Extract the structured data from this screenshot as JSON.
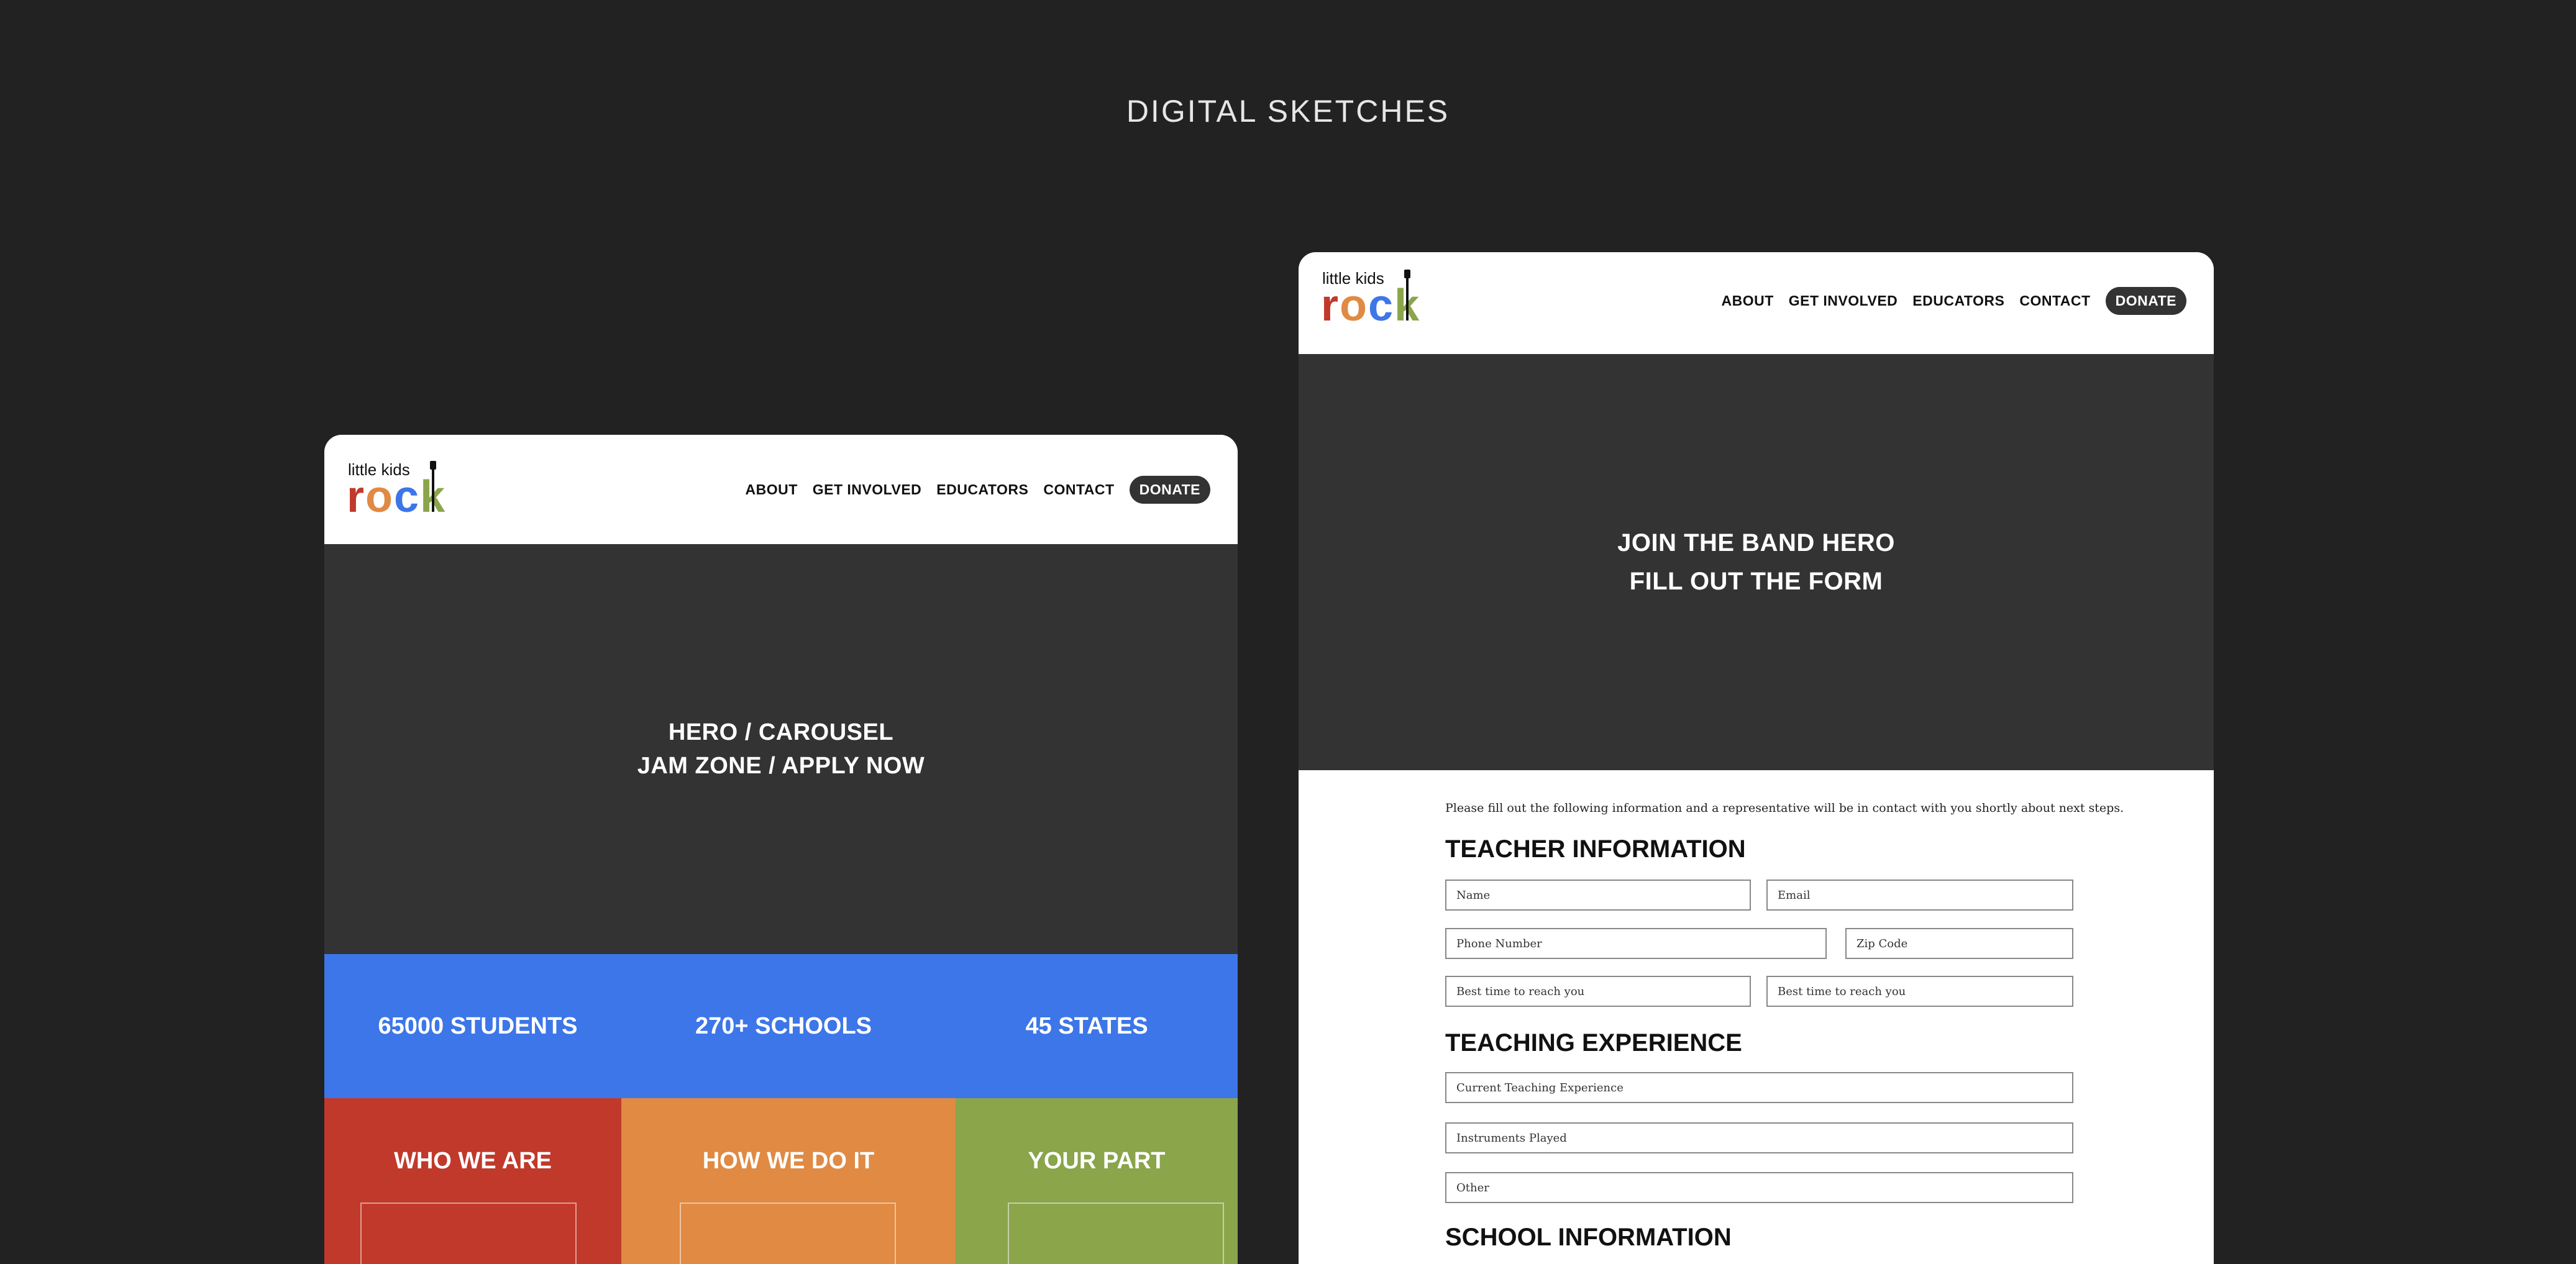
{
  "page_title": "DIGITAL SKETCHES",
  "logo": {
    "small_text": "little kids",
    "big_text": "rock",
    "letters": [
      "r",
      "o",
      "c",
      "k"
    ],
    "letter_colors": [
      "#c0392b",
      "#e08a44",
      "#3d76e8",
      "#8aa54a"
    ]
  },
  "nav": {
    "items": [
      "ABOUT",
      "GET INVOLVED",
      "EDUCATORS",
      "CONTACT"
    ],
    "donate": "DONATE"
  },
  "left_sketch": {
    "hero_lines": [
      "HERO / CAROUSEL",
      "JAM ZONE / APPLY NOW"
    ],
    "stats": [
      "65000 STUDENTS",
      "270+ SCHOOLS",
      "45 STATES"
    ],
    "cards": [
      {
        "title": "WHO WE ARE",
        "color": "#c0392b"
      },
      {
        "title": "HOW WE DO IT",
        "color": "#e08a44"
      },
      {
        "title": "YOUR PART",
        "color": "#8aa54a"
      }
    ]
  },
  "right_sketch": {
    "hero_lines": [
      "JOIN THE BAND HERO",
      "FILL OUT THE FORM"
    ],
    "intro": "Please fill out the following information and a representative will be in contact with you shortly about next steps.",
    "sections": {
      "teacher": "TEACHER INFORMATION",
      "experience": "TEACHING EXPERIENCE",
      "school": "SCHOOL INFORMATION"
    },
    "fields": {
      "name": "Name",
      "email": "Email",
      "phone": "Phone Number",
      "zip": "Zip Code",
      "best_time_1": "Best time to reach you",
      "best_time_2": "Best time to reach you",
      "current_experience": "Current Teaching Experience",
      "instruments": "Instruments Played",
      "other": "Other"
    }
  },
  "colors": {
    "background": "#222222",
    "hero": "#333333",
    "stats_blue": "#3d76e8",
    "red": "#c0392b",
    "orange": "#e08a44",
    "green": "#8aa54a"
  }
}
